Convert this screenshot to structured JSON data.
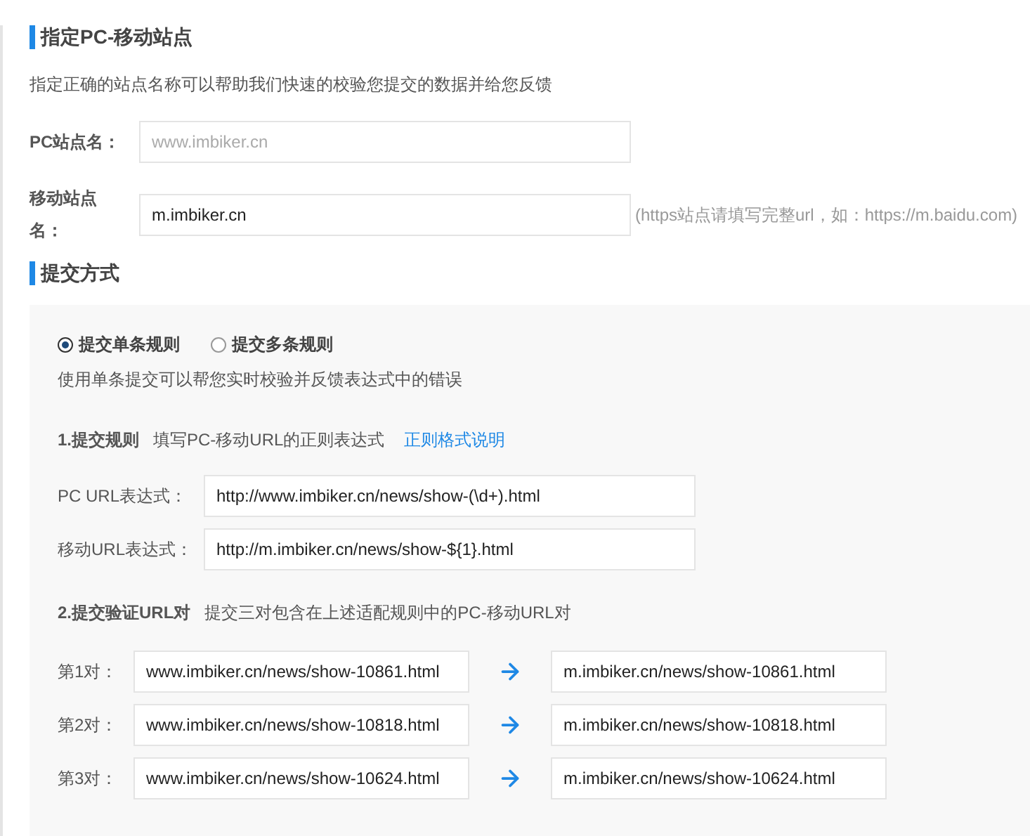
{
  "site": {
    "heading": "指定PC-移动站点",
    "description": "指定正确的站点名称可以帮助我们快速的校验您提交的数据并给您反馈",
    "fields": [
      {
        "label": "PC站点名：",
        "placeholder": "www.imbiker.cn"
      },
      {
        "label": "移动站点名：",
        "value": "m.imbiker.cn",
        "hint": "(https站点请填写完整url，如：https://m.baidu.com)"
      }
    ]
  },
  "submit": {
    "heading": "提交方式",
    "modes": [
      {
        "label": "提交单条规则",
        "selected": true
      },
      {
        "label": "提交多条规则",
        "selected": false
      }
    ],
    "mode_description": "使用单条提交可以帮您实时校验并反馈表达式中的错误",
    "rule": {
      "step": "1.提交规则",
      "instruction": "填写PC-移动URL的正则表达式",
      "link": "正则格式说明"
    },
    "expressions": [
      {
        "label": "PC URL表达式：",
        "value": "http://www.imbiker.cn/news/show-(\\d+).html"
      },
      {
        "label": "移动URL表达式：",
        "value": "http://m.imbiker.cn/news/show-${1}.html"
      }
    ],
    "pairs_step": {
      "step": "2.提交验证URL对",
      "instruction": "提交三对包含在上述适配规则中的PC-移动URL对"
    },
    "pairs": [
      {
        "label": "第1对：",
        "pc": "www.imbiker.cn/news/show-10861.html",
        "mobile": "m.imbiker.cn/news/show-10861.html"
      },
      {
        "label": "第2对：",
        "pc": "www.imbiker.cn/news/show-10818.html",
        "mobile": "m.imbiker.cn/news/show-10818.html"
      },
      {
        "label": "第3对：",
        "pc": "www.imbiker.cn/news/show-10624.html",
        "mobile": "m.imbiker.cn/news/show-10624.html"
      }
    ]
  }
}
